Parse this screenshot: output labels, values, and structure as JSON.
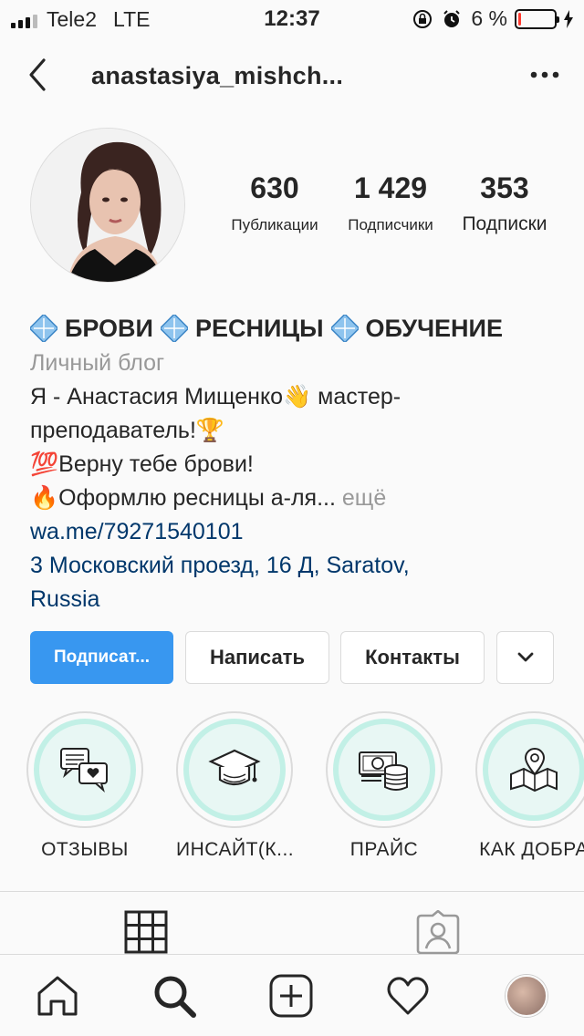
{
  "status_bar": {
    "carrier": "Tele2",
    "network": "LTE",
    "time": "12:37",
    "battery_percent": "6 %",
    "battery_level": 0.06,
    "battery_color": "#ff3b30"
  },
  "header": {
    "username": "anastasiya_mishch...",
    "back_icon": "chevron-left-icon",
    "more_icon": "more-horizontal-icon"
  },
  "profile": {
    "stats": [
      {
        "value": "630",
        "label": "Публикации"
      },
      {
        "value": "1 429",
        "label": "Подписчики"
      },
      {
        "value": "353",
        "label": "Подписки"
      }
    ]
  },
  "bio": {
    "name_parts": [
      "БРОВИ",
      "РЕСНИЦЫ",
      "ОБУЧЕНИЕ"
    ],
    "category": "Личный блог",
    "line1": "Я - Анастасия Мищенко",
    "line1_emoji": "👋",
    "line1_end": " мастер-",
    "line2": "преподаватель!",
    "line2_emoji": "🏆",
    "line3_emoji": "💯",
    "line3": "Верну тебе брови!",
    "line4_emoji": "🔥",
    "line4": "Оформлю ресницы а-ля...",
    "more": "ещё",
    "link": "wa.me/79271540101",
    "address_line1": "3 Московский проезд, 16 Д, Saratov,",
    "address_line2": "Russia"
  },
  "buttons": {
    "follow": "Подписат...",
    "message": "Написать",
    "contacts": "Контакты",
    "dropdown_icon": "chevron-down-icon"
  },
  "highlights": [
    {
      "label": "ОТЗЫВЫ",
      "icon": "chat-heart-icon"
    },
    {
      "label": "ИНСАЙТ(К...",
      "icon": "graduation-cap-icon"
    },
    {
      "label": "ПРАЙС",
      "icon": "money-coins-icon"
    },
    {
      "label": "КАК ДОБРА",
      "icon": "map-pin-icon"
    }
  ],
  "colors": {
    "accent": "#3897f0",
    "link": "#00376b",
    "highlight_ring": "#c2f0e6"
  }
}
